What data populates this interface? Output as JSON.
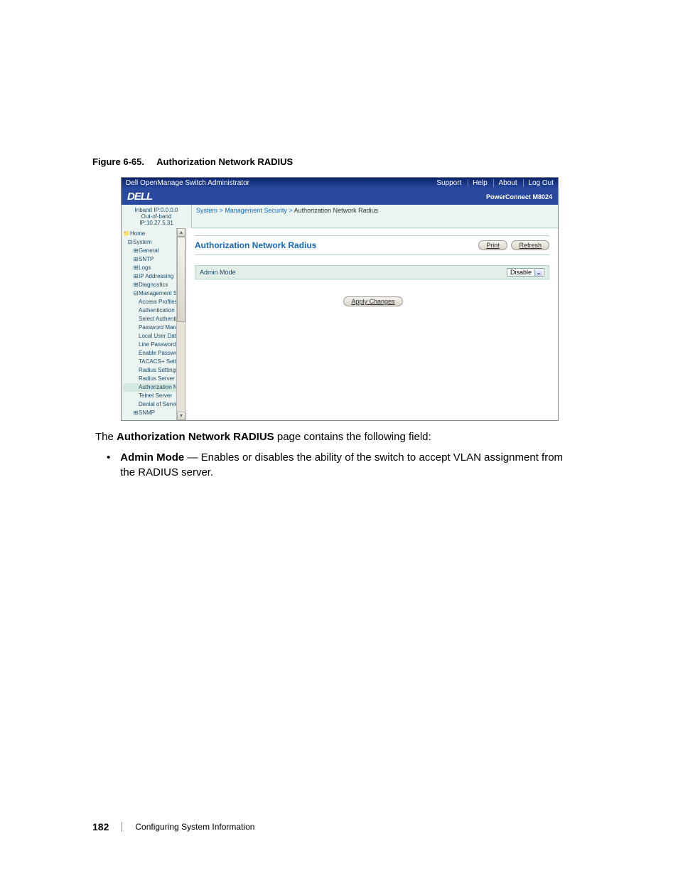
{
  "figure": {
    "number": "Figure 6-65.",
    "title": "Authorization Network RADIUS"
  },
  "screenshot": {
    "title_bar": {
      "app_title": "Dell OpenManage Switch Administrator",
      "links": [
        "Support",
        "Help",
        "About",
        "Log Out"
      ]
    },
    "logo_row": {
      "logo_text": "DELL",
      "product": "PowerConnect M8024"
    },
    "ip_info": {
      "inband": "Inband IP:0.0.0.0",
      "outband": "Out-of-band IP:10.27.5.31"
    },
    "breadcrumb": [
      "System",
      "Management Security",
      "Authorization Network Radius"
    ],
    "tree": {
      "home": "Home",
      "system": "System",
      "children_l2": [
        "General",
        "SNTP",
        "Logs",
        "IP Addressing",
        "Diagnostics"
      ],
      "mgmt_sec": "Management Secur",
      "children_l3": [
        "Access Profiles",
        "Authentication P",
        "Select Authentic",
        "Password Manag",
        "Local User Datab",
        "Line Password",
        "Enable Passwor",
        "TACACS+ Settin",
        "Radius Settings",
        "Radius Server Ac",
        "Authorization N",
        "Telnet Server",
        "Denial of Service"
      ],
      "snmp": "SNMP"
    },
    "content": {
      "page_title": "Authorization Network Radius",
      "buttons": {
        "print": "Print",
        "refresh": "Refresh"
      },
      "form": {
        "admin_mode_label": "Admin Mode",
        "admin_mode_value": "Disable"
      },
      "apply_label": "Apply Changes"
    }
  },
  "body": {
    "intro_pre": "The ",
    "intro_bold": "Authorization Network RADIUS",
    "intro_post": " page contains the following field:",
    "bullet_bold": "Admin Mode",
    "bullet_text": "— Enables or disables the ability of the switch to accept VLAN assignment from the RADIUS server."
  },
  "footer": {
    "page_number": "182",
    "section": "Configuring System Information"
  }
}
